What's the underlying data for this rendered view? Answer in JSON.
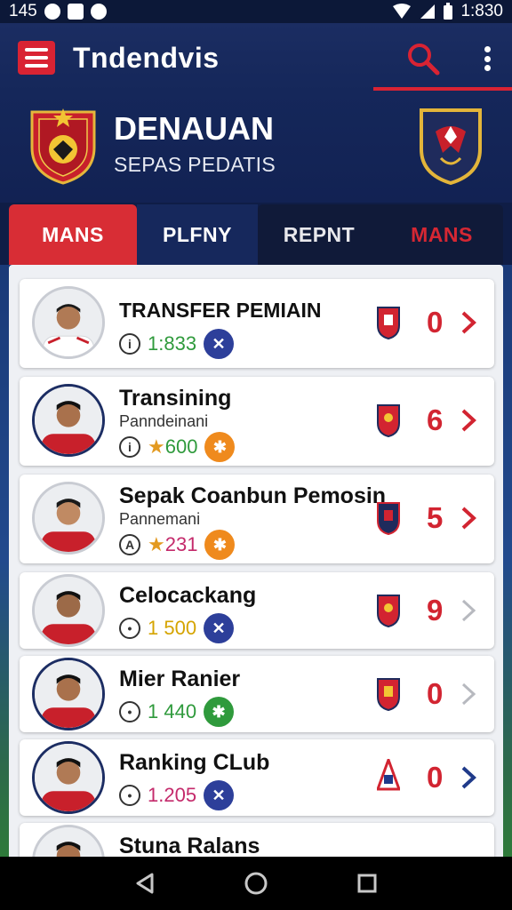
{
  "status_bar": {
    "left_text": "145",
    "time": "1:830"
  },
  "app_bar": {
    "title": "Tndendvis"
  },
  "match": {
    "title": "DENAUAN",
    "subtitle": "SEPAS PEDATIS"
  },
  "tabs": [
    {
      "label": "MANS"
    },
    {
      "label": "PLFNY"
    },
    {
      "label": "REPNT"
    },
    {
      "label": "MANS"
    }
  ],
  "items": [
    {
      "title": "TRANSFER PEMIAIN",
      "subtitle": "",
      "stat": "1:833",
      "stat_color": "#2f9a3c",
      "star": false,
      "info": "i",
      "badge_color": "#2d3f9a",
      "badge_icon": "runner-icon",
      "count": "0",
      "chevron_color": "#d22431"
    },
    {
      "title": "Transining",
      "subtitle": "Panndeinani",
      "stat": "600",
      "stat_color": "#2f9a3c",
      "star": true,
      "info": "i",
      "badge_color": "#ef8a1d",
      "badge_icon": "ball-icon",
      "count": "6",
      "chevron_color": "#d22431"
    },
    {
      "title": "Sepak Coanbun Pemosin",
      "subtitle": "Pannemani",
      "stat": "231",
      "stat_color": "#c42a6b",
      "star": true,
      "info": "A",
      "badge_color": "#ef8a1d",
      "badge_icon": "ball-icon",
      "count": "5",
      "chevron_color": "#d22431"
    },
    {
      "title": "Celocackang",
      "subtitle": "",
      "stat": "1 500",
      "stat_color": "#d5a400",
      "star": false,
      "info": "•",
      "badge_color": "#2d3f9a",
      "badge_icon": "runner-icon",
      "count": "9",
      "chevron_color": "#b7b9bf"
    },
    {
      "title": "Mier Ranier",
      "subtitle": "",
      "stat": "1 440",
      "stat_color": "#2f9a3c",
      "star": false,
      "info": "•",
      "badge_color": "#2f9a3c",
      "badge_icon": "ball-icon",
      "count": "0",
      "chevron_color": "#b7b9bf"
    },
    {
      "title": "Ranking CLub",
      "subtitle": "",
      "stat": "1.205",
      "stat_color": "#c42a6b",
      "star": false,
      "info": "•",
      "badge_color": "#2d3f9a",
      "badge_icon": "runner-icon",
      "count": "0",
      "chevron_color": "#1f3a8a"
    },
    {
      "title": "Stuna Ralans",
      "subtitle": "",
      "stat": "",
      "stat_color": "#2f9a3c",
      "star": false,
      "info": "",
      "badge_color": "#2d3f9a",
      "badge_icon": "",
      "count": "",
      "chevron_color": "#d22431"
    }
  ]
}
